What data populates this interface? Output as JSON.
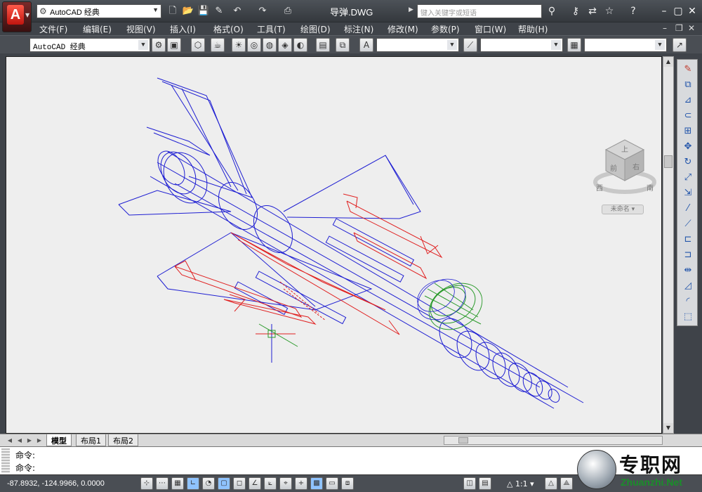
{
  "app": {
    "workspace": "AutoCAD 经典",
    "document_title": "导弹.DWG",
    "search_placeholder": "键入关键字或短语"
  },
  "menu": [
    "文件(F)",
    "编辑(E)",
    "视图(V)",
    "插入(I)",
    "格式(O)",
    "工具(T)",
    "绘图(D)",
    "标注(N)",
    "修改(M)",
    "参数(P)",
    "窗口(W)",
    "帮助(H)"
  ],
  "toolbar": {
    "workspace_select": "AutoCAD 经典",
    "style_select_1": "",
    "style_select_2": "",
    "style_select_3": ""
  },
  "viewcube": {
    "face_top": "上",
    "face_front": "前",
    "face_right": "右",
    "compass_w": "西",
    "compass_s": "南",
    "label": "未命名"
  },
  "tabs": [
    "模型",
    "布局1",
    "布局2"
  ],
  "command": {
    "line1": "命令:",
    "line2": "命令:"
  },
  "status": {
    "coords": "-87.8932, -124.9966, 0.0000",
    "scale": "1:1"
  },
  "watermark": {
    "cn": "专职网",
    "en": "Zhuanzhi.Net"
  },
  "colors": {
    "wire_blue": "#1e1ed2",
    "wire_red": "#e02020",
    "wire_green": "#2a9a2a",
    "canvas_bg": "#eeeeee"
  }
}
